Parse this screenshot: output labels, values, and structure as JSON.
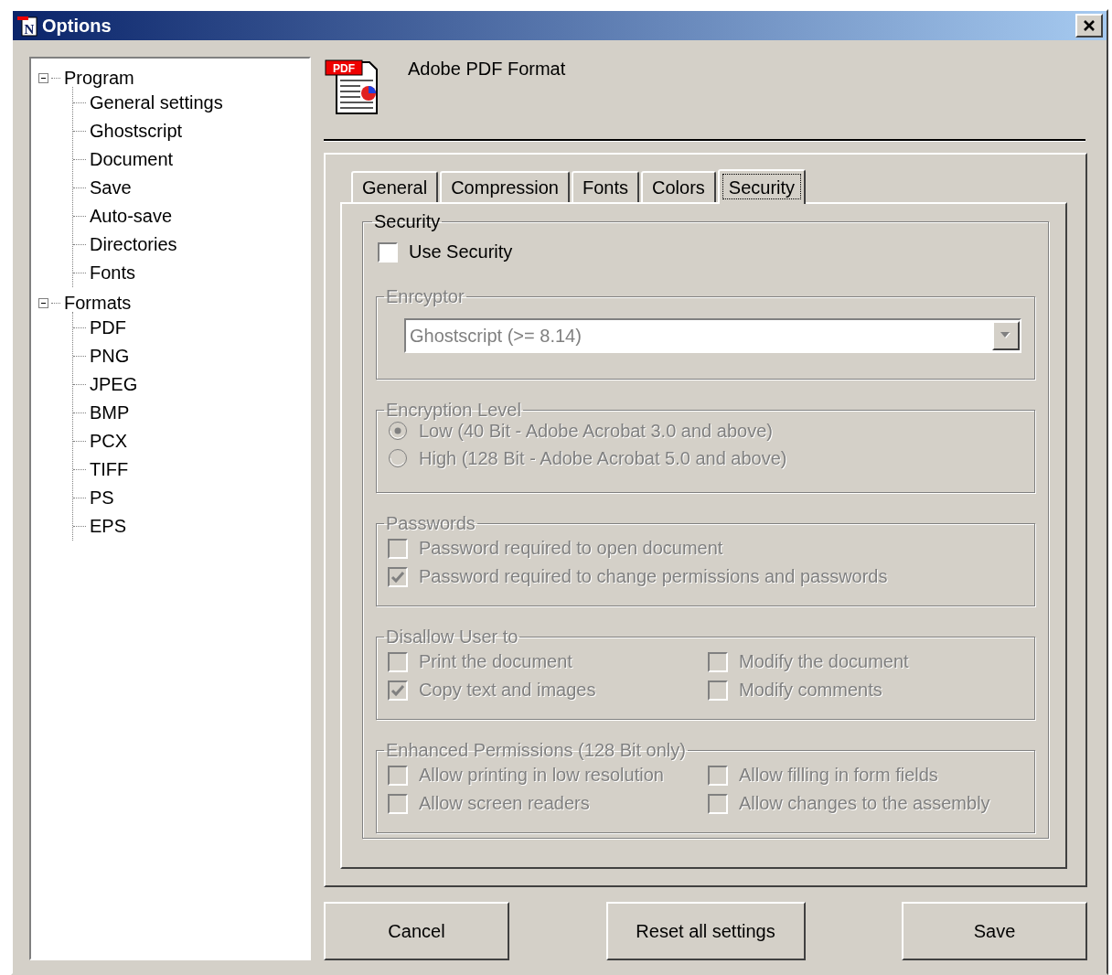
{
  "window": {
    "title": "Options",
    "icon_letter": "N"
  },
  "tree": [
    {
      "label": "Program",
      "expanded": true,
      "children": [
        {
          "label": "General settings"
        },
        {
          "label": "Ghostscript"
        },
        {
          "label": "Document"
        },
        {
          "label": "Save"
        },
        {
          "label": "Auto-save"
        },
        {
          "label": "Directories"
        },
        {
          "label": "Fonts"
        }
      ]
    },
    {
      "label": "Formats",
      "expanded": true,
      "children": [
        {
          "label": "PDF"
        },
        {
          "label": "PNG"
        },
        {
          "label": "JPEG"
        },
        {
          "label": "BMP"
        },
        {
          "label": "PCX"
        },
        {
          "label": "TIFF"
        },
        {
          "label": "PS"
        },
        {
          "label": "EPS"
        }
      ]
    }
  ],
  "header": {
    "icon_label": "PDF",
    "title": "Adobe PDF Format"
  },
  "tabs": [
    {
      "label": "General",
      "selected": false
    },
    {
      "label": "Compression",
      "selected": false
    },
    {
      "label": "Fonts",
      "selected": false
    },
    {
      "label": "Colors",
      "selected": false
    },
    {
      "label": "Security",
      "selected": true
    }
  ],
  "security": {
    "title": "Security",
    "use_security": {
      "label": "Use Security",
      "checked": false
    },
    "groups": [
      {
        "kind": "dropdown",
        "title": "Enrcyptor",
        "disabled": true,
        "value": "Ghostscript (>= 8.14)"
      },
      {
        "kind": "radios",
        "title": "Encryption Level",
        "disabled": true,
        "options": [
          {
            "label": "Low (40 Bit - Adobe Acrobat 3.0 and above)",
            "selected": true
          },
          {
            "label": "High (128 Bit - Adobe Acrobat 5.0 and above)",
            "selected": false
          }
        ]
      },
      {
        "kind": "checks",
        "title": "Passwords",
        "disabled": true,
        "options": [
          {
            "label": "Password required to open document",
            "checked": false
          },
          {
            "label": "Password required to change permissions and passwords",
            "checked": true
          }
        ]
      },
      {
        "kind": "check_grid",
        "title": "Disallow User to",
        "disabled": true,
        "options": [
          {
            "label": "Print the document",
            "checked": false
          },
          {
            "label": "Modify the document",
            "checked": false
          },
          {
            "label": "Copy text and images",
            "checked": true
          },
          {
            "label": "Modify comments",
            "checked": false
          }
        ]
      },
      {
        "kind": "check_grid",
        "title": "Enhanced Permissions (128 Bit only)",
        "disabled": true,
        "options": [
          {
            "label": "Allow printing in low resolution",
            "checked": false
          },
          {
            "label": "Allow filling in form fields",
            "checked": false
          },
          {
            "label": "Allow screen readers",
            "checked": false
          },
          {
            "label": "Allow changes to the assembly",
            "checked": false
          }
        ]
      }
    ]
  },
  "buttons": [
    "Cancel",
    "Reset all settings",
    "Save"
  ]
}
